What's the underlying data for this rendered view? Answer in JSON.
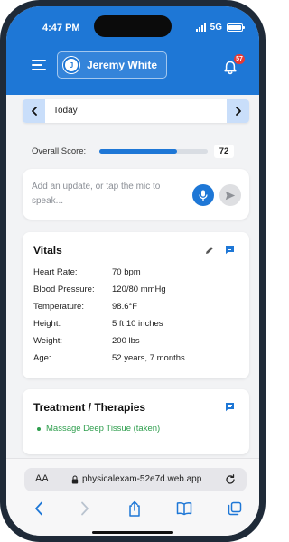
{
  "status": {
    "time": "4:47 PM",
    "network": "5G"
  },
  "header": {
    "user_initial": "J",
    "user_name": "Jeremy White",
    "notification_count": "57"
  },
  "date_nav": {
    "label": "Today"
  },
  "score": {
    "label": "Overall Score:",
    "value": "72",
    "fraction": 0.72
  },
  "update": {
    "placeholder": "Add an update, or tap the mic to speak..."
  },
  "vitals": {
    "title": "Vitals",
    "rows": [
      {
        "label": "Heart Rate:",
        "value": "70 bpm"
      },
      {
        "label": "Blood Pressure:",
        "value": "120/80 mmHg"
      },
      {
        "label": "Temperature:",
        "value": "98.6°F"
      },
      {
        "label": "Height:",
        "value": "5 ft 10 inches"
      },
      {
        "label": "Weight:",
        "value": "200 lbs"
      },
      {
        "label": "Age:",
        "value": "52 years, 7 months"
      }
    ]
  },
  "treatments": {
    "title": "Treatment / Therapies",
    "items": [
      {
        "label": "Massage Deep Tissue (taken)"
      }
    ]
  },
  "browser": {
    "aa_label": "AA",
    "url": "physicalexam-52e7d.web.app"
  },
  "colors": {
    "primary": "#1e77d6",
    "success": "#2e9e4d",
    "badge": "#e53935",
    "background": "#f2f3f5"
  }
}
